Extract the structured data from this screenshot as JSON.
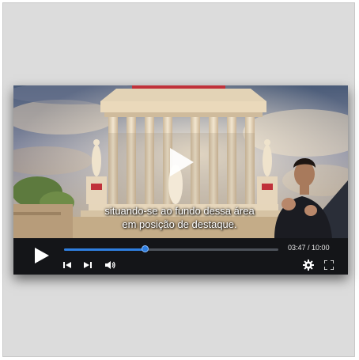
{
  "player": {
    "subtitle_line1": "situando-se ao fundo dessa área",
    "subtitle_line2": "em posição de destaque.",
    "current_time": "03:47",
    "duration": "10:00",
    "time_separator": " / ",
    "progress_fraction": 0.378,
    "accent_color": "#2f7fe0"
  },
  "icons": {
    "big_play": "play-icon",
    "play": "play-icon",
    "prev": "skip-back-icon",
    "next": "skip-forward-icon",
    "volume": "volume-icon",
    "settings": "gear-icon",
    "fullscreen": "fullscreen-icon"
  }
}
